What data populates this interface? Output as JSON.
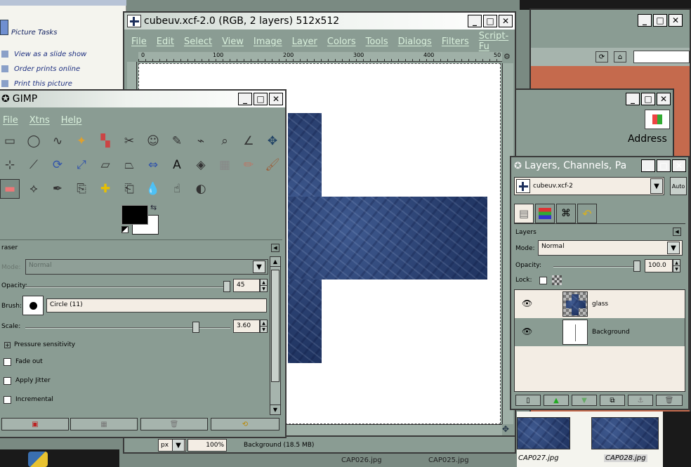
{
  "colors": {
    "desktop": "#7a8a82",
    "panel_bg": "#8a9c93",
    "canvas": "#ffffff",
    "fabric": "#2f4a80",
    "field_bg": "#f3ede4",
    "browser_bg": "#c56a4d",
    "menu_text": "#d9f0dc"
  },
  "explorer": {
    "section_title": "Picture Tasks",
    "tasks": [
      "View as a slide show",
      "Order prints online",
      "Print this picture"
    ]
  },
  "image_window": {
    "title": "cubeuv.xcf-2.0 (RGB, 2 layers) 512x512",
    "menu": [
      "File",
      "Edit",
      "Select",
      "View",
      "Image",
      "Layer",
      "Colors",
      "Tools",
      "Dialogs",
      "Filters",
      "Script-Fu"
    ],
    "ruler_ticks": [
      "0",
      "100",
      "200",
      "300",
      "400",
      "50"
    ],
    "status": {
      "unit": "px",
      "zoom": "100%",
      "info": "Background (18.5 MB)"
    }
  },
  "toolbox": {
    "title": "GIMP",
    "menu": [
      "File",
      "Xtns",
      "Help"
    ],
    "tool_icons": [
      "rect-select-icon",
      "ellipse-select-icon",
      "lasso-icon",
      "fuzzy-select-icon",
      "color-select-icon",
      "scissors-icon",
      "foreground-select-icon",
      "paths-icon",
      "color-picker-icon",
      "zoom-icon",
      "measure-icon",
      "move-icon",
      "align-icon",
      "knife-icon",
      "rotate-icon",
      "scale-icon",
      "shear-icon",
      "perspective-icon",
      "flip-icon",
      "text-icon",
      "bucket-fill-icon",
      "blend-icon",
      "pencil-icon",
      "paintbrush-icon",
      "eraser-icon",
      "airbrush-icon",
      "ink-icon",
      "clone-icon",
      "heal-icon",
      "perspective-clone-icon",
      "blur-icon",
      "smudge-icon",
      "dodge-burn-icon"
    ],
    "options_title": "raser",
    "mode_label": "Mode:",
    "mode_value": "Normal",
    "opacity_label": "Opacity:",
    "opacity_value": "45",
    "opacity_fraction": 0.45,
    "brush_label": "Brush:",
    "brush_value": "Circle (11)",
    "scale_label": "Scale:",
    "scale_value": "3.60",
    "pressure_label": "Pressure sensitivity",
    "checkboxes": [
      "Fade out",
      "Apply Jitter",
      "Incremental"
    ]
  },
  "browser": {
    "address_label": "Address"
  },
  "layers": {
    "title": "Layers, Channels, Pa",
    "image_name": "cubeuv.xcf-2",
    "auto_label": "Auto",
    "section": "Layers",
    "mode_label": "Mode:",
    "mode_value": "Normal",
    "opacity_label": "Opacity:",
    "opacity_value": "100.0",
    "lock_label": "Lock:",
    "items": [
      {
        "name": "glass"
      },
      {
        "name": "Background"
      }
    ]
  },
  "thumbnails": {
    "labels": [
      "CAP027.jpg",
      "CAP028.jpg"
    ],
    "partial_labels": [
      "CAP026.jpg",
      "CAP025.jpg"
    ]
  }
}
